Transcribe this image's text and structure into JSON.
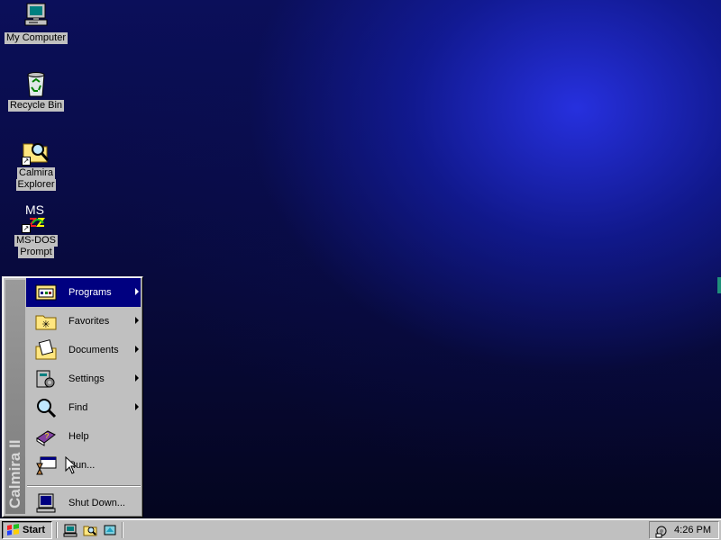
{
  "desktop": {
    "icons": [
      {
        "label": "My Computer",
        "icon": "my-computer-icon"
      },
      {
        "label": "Recycle Bin",
        "icon": "recycle-bin-icon"
      },
      {
        "label_line1": "Calmira",
        "label_line2": "Explorer",
        "icon": "explorer-icon"
      },
      {
        "label_line1": "MS-DOS",
        "label_line2": "Prompt",
        "icon": "ms-dos-icon",
        "icon_text": "MS"
      }
    ]
  },
  "start_menu": {
    "sidebar_text": "Calmira II",
    "items": [
      {
        "label": "Programs",
        "icon": "programs-icon",
        "submenu": true,
        "highlighted": true
      },
      {
        "label": "Favorites",
        "icon": "favorites-icon",
        "submenu": true
      },
      {
        "label": "Documents",
        "icon": "documents-icon",
        "submenu": true
      },
      {
        "label": "Settings",
        "icon": "settings-icon",
        "submenu": true
      },
      {
        "label": "Find",
        "icon": "find-icon",
        "submenu": true
      },
      {
        "label": "Help",
        "icon": "help-icon",
        "submenu": false
      },
      {
        "label": "Run...",
        "icon": "run-icon",
        "submenu": false
      },
      {
        "label": "Shut Down...",
        "icon": "shutdown-icon",
        "submenu": false
      }
    ]
  },
  "taskbar": {
    "start_label": "Start",
    "quick_launch": [
      "desktop-icon",
      "explorer-icon",
      "browser-icon"
    ],
    "clock": "4:26 PM",
    "tray_icon": "tray-settings-icon"
  },
  "colors": {
    "highlight": "#000080",
    "face": "#c0c0c0",
    "desktop": "#0b0f5a"
  }
}
